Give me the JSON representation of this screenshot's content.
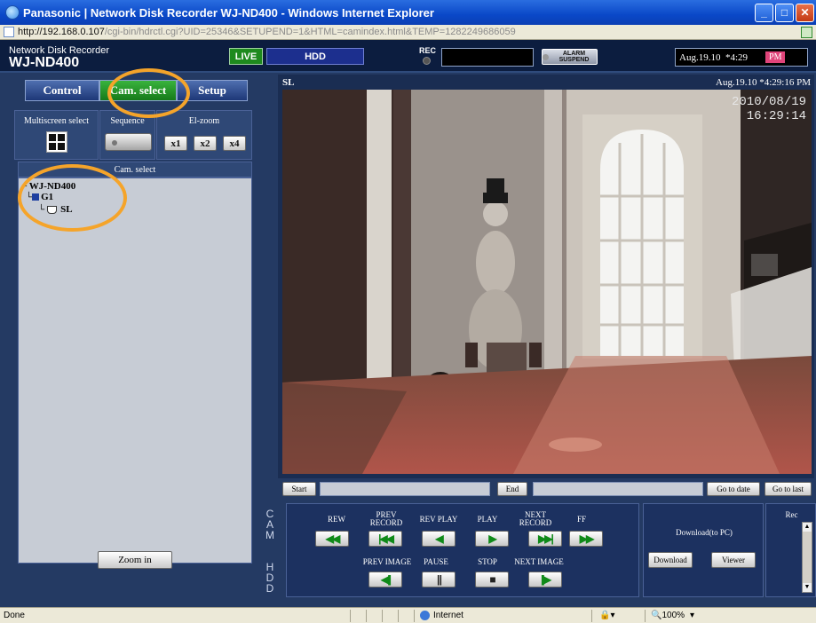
{
  "browser": {
    "title": "Panasonic | Network Disk Recorder WJ-ND400 - Windows Internet Explorer",
    "url_host": "http://192.168.0.107",
    "url_path": "/cgi-bin/hdrctl.cgi?UID=25346&SETUPEND=1&HTML=camindex.html&TEMP=1282249686059",
    "status_left": "Done",
    "status_zone": "Internet",
    "status_zoom": "100%"
  },
  "header": {
    "brand_sub": "Network Disk Recorder",
    "brand_main": "WJ-ND400",
    "live_label": "LIVE",
    "hdd_label": "HDD",
    "rec_label": "REC",
    "alarm_label": "ALARM SUSPEND",
    "date": "Aug.19.10",
    "time": "*4:29",
    "ampm": "PM"
  },
  "tabs": {
    "control": "Control",
    "cam_select": "Cam. select",
    "setup": "Setup"
  },
  "controls": {
    "multiscreen_label": "Multiscreen select",
    "sequence_label": "Sequence",
    "elzoom_label": "El-zoom",
    "zoom_x1": "x1",
    "zoom_x2": "x2",
    "zoom_x4": "x4"
  },
  "cam_select": {
    "header": "Cam. select",
    "root": "WJ-ND400",
    "group": "G1",
    "camera": "SL",
    "zoom_in": "Zoom in"
  },
  "video": {
    "label": "SL",
    "date_time": "Aug.19.10  *4:29:16 PM",
    "osd_date": "2010/08/19",
    "osd_time": "16:29:14"
  },
  "range": {
    "start": "Start",
    "end": "End",
    "go_to_date": "Go to date",
    "go_to_last": "Go to last"
  },
  "side_tabs": {
    "cam": [
      "C",
      "A",
      "M"
    ],
    "hdd": [
      "H",
      "D",
      "D"
    ]
  },
  "playback": {
    "rew": "REW",
    "prev_record_1": "PREV",
    "prev_record_2": "RECORD",
    "rev_play": "REV PLAY",
    "play": "PLAY",
    "next_record_1": "NEXT",
    "next_record_2": "RECORD",
    "ff": "FF",
    "prev_image": "PREV IMAGE",
    "pause": "PAUSE",
    "stop": "STOP",
    "next_image": "NEXT IMAGE"
  },
  "download": {
    "title": "Download(to PC)",
    "download_btn": "Download",
    "viewer_btn": "Viewer",
    "rec_label": "Rec"
  },
  "colors": {
    "annotation_ring": "#f5a42a",
    "active_tab": "#1e8a1e",
    "play_arrow": "#0f8a19"
  }
}
